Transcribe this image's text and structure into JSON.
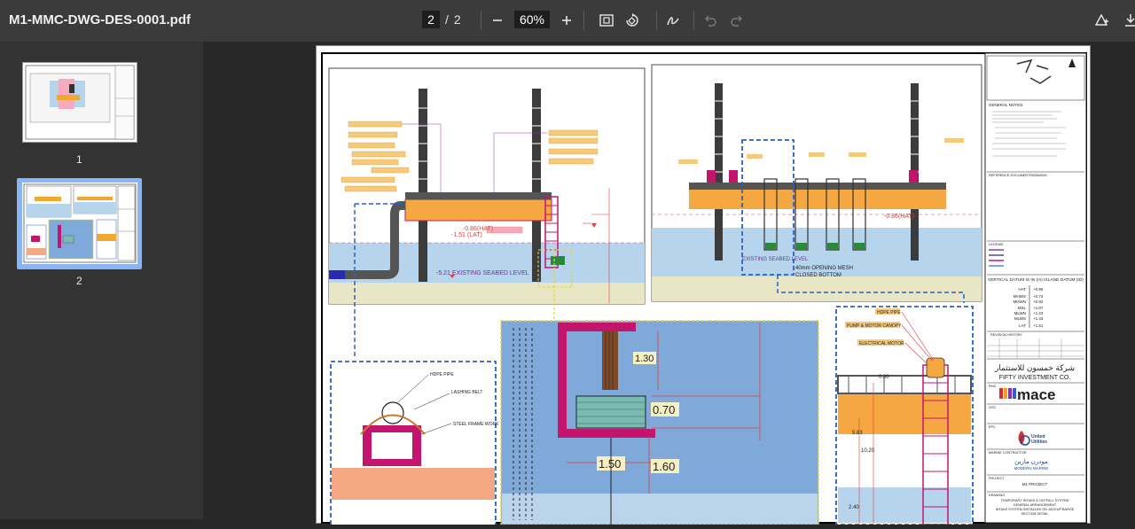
{
  "toolbar": {
    "title": "M1-MMC-DWG-DES-0001.pdf",
    "current_page": "2",
    "page_separator": "/",
    "total_pages": "2",
    "zoom": "60%"
  },
  "icons": {
    "zoom_out": "minus-icon",
    "zoom_in": "plus-icon",
    "fit": "fit-page-icon",
    "rotate": "rotate-icon",
    "draw": "draw-icon",
    "undo": "undo-icon",
    "redo": "redo-icon",
    "annotate": "add-annotation-icon",
    "download": "download-icon"
  },
  "thumbnails": [
    {
      "label": "1"
    },
    {
      "label": "2"
    }
  ],
  "drawing": {
    "title_block": {
      "general_notes": "GENERAL NOTES:",
      "reference": "REFERENCE DOCUMENT/DRAWING",
      "legend": "LEGEND",
      "datum_title": "VERTICAL DATUM IS IN (m) ISLAND DATUM (ID)",
      "datum_rows": [
        {
          "label": "HAT",
          "value": "+0.86"
        },
        {
          "label": "MHWS",
          "value": "+0.73"
        },
        {
          "label": "MHWN",
          "value": "+0.92"
        },
        {
          "label": "MSL",
          "value": "+1.07"
        },
        {
          "label": "MLWN",
          "value": "+1.23"
        },
        {
          "label": "MLWS",
          "value": "+1.43"
        },
        {
          "label": "LAT",
          "value": "+1.51"
        }
      ],
      "revision": "REVISION HISTORY",
      "client_ar": "شركة خمسون للاستثمار",
      "client_en": "FIFTY INVESTMENT CO.",
      "pmc": "PMC",
      "mace": "mace",
      "uu_line1": "United",
      "uu_line2": "Utilities",
      "marine_contractor": "MARINE CONTRACTOR",
      "modern_ar": "مودرن مارين",
      "modern_en": "MODERN MARINE",
      "project_label": "PROJECT",
      "project": "M1 PROJECT",
      "drawing_label": "DRAWING",
      "drawing_title_1": "TEMPORARY INTAKE & OUTFALL SYSTEM",
      "drawing_title_2": "GENERAL ARRANGEMENT",
      "drawing_title_3": "INTAKE SYSTEM INSTALLED ON JACKUP BARGE",
      "drawing_title_4": "SECTION DETAIL",
      "gsc": "GSC",
      "epc": "EPC"
    },
    "labels": {
      "existing_seabed": "-5.21 EXISTING SEABED LEVEL",
      "existing_seabed_2": "EXISTING SEABED LEVEL",
      "lat": "-1.51 (LAT)",
      "hat": "-0.86(HAT)",
      "hat_2": "-0.86(HAT)",
      "opening_mesh": "40mm OPENING MESH",
      "closed_bottom": "CLOSED BOTTOM",
      "hdpe_pipe": "HDPE PIPE",
      "lashing_belt": "LASHING BELT",
      "steel_frame": "STEEL FRAME WORK",
      "hdpe_pipe_2": "HDPE PIPE",
      "pump_canopy": "PUMP & MOTOR CANOPY",
      "electrical_motor": "ELECTRICAL MOTOR",
      "dim_130": "1.30",
      "dim_070": "0.70",
      "dim_150": "1.50",
      "dim_160": "1.60",
      "dim_080": "0.80",
      "dim_583": "5.83",
      "dim_1020": "10.20",
      "dim_240": "2.40",
      "msl_small": "-0.86(HAT)"
    }
  }
}
